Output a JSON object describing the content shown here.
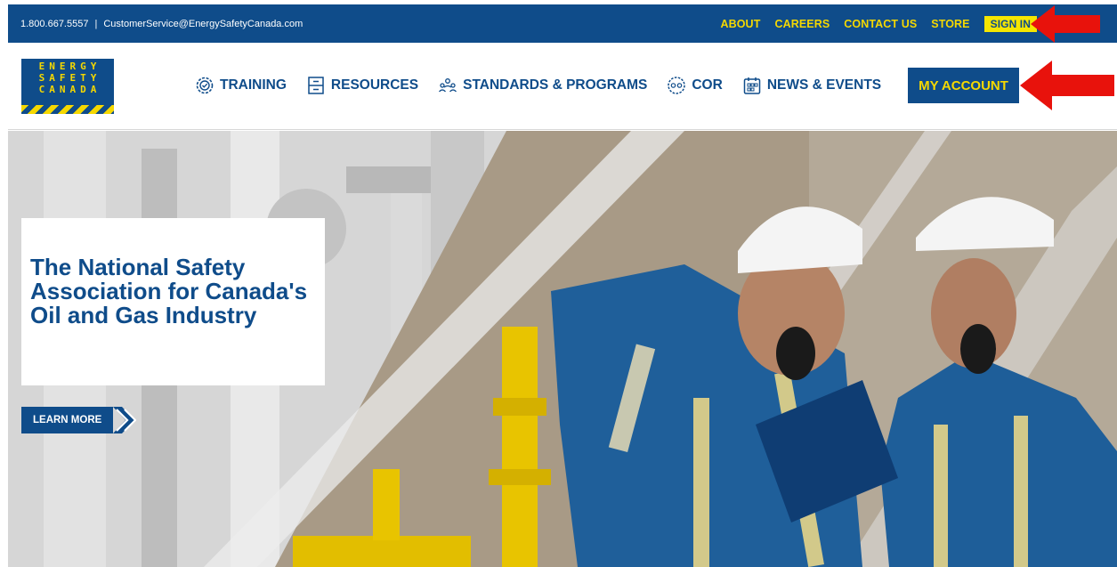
{
  "topbar": {
    "phone": "1.800.667.5557",
    "separator": "|",
    "email": "CustomerService@EnergySafetyCanada.com",
    "links": [
      "ABOUT",
      "CAREERS",
      "CONTACT US",
      "STORE"
    ],
    "signin_label": "SIGN IN"
  },
  "logo": {
    "lines": [
      "ENERGY",
      "SAFETY",
      "CANADA"
    ]
  },
  "nav": {
    "items": [
      {
        "label": "TRAINING",
        "icon": "gear-check-icon"
      },
      {
        "label": "RESOURCES",
        "icon": "filing-cabinet-icon"
      },
      {
        "label": "STANDARDS & PROGRAMS",
        "icon": "people-group-icon"
      },
      {
        "label": "COR",
        "icon": "cor-badge-icon"
      },
      {
        "label": "NEWS & EVENTS",
        "icon": "calendar-icon"
      }
    ],
    "account_label": "MY ACCOUNT"
  },
  "hero": {
    "title": "The National Safety Association for Canada's Oil and Gas Industry",
    "cta_label": "LEARN MORE"
  },
  "colors": {
    "brand_blue": "#0f4c8a",
    "brand_yellow": "#f5d800",
    "annotation_red": "#e8120c"
  }
}
